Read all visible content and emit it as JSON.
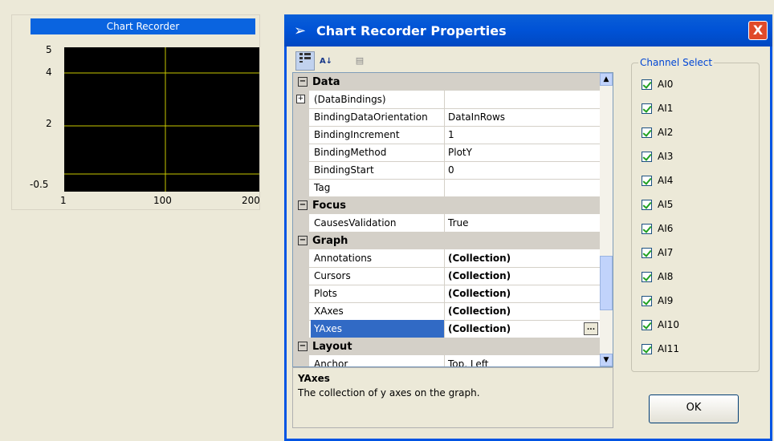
{
  "recorder": {
    "title": "Chart Recorder",
    "y_ticks": [
      "5",
      "4",
      "2",
      "-0.5"
    ],
    "x_ticks": [
      "1",
      "100",
      "200"
    ]
  },
  "dialog": {
    "title": "Chart Recorder Properties",
    "close_label": "X"
  },
  "grid": {
    "categories": [
      {
        "label": "Data"
      },
      {
        "label": "Focus"
      },
      {
        "label": "Graph"
      },
      {
        "label": "Layout"
      }
    ],
    "rows": [
      {
        "name": "(DataBindings)",
        "value": ""
      },
      {
        "name": "BindingDataOrientation",
        "value": "DataInRows"
      },
      {
        "name": "BindingIncrement",
        "value": "1"
      },
      {
        "name": "BindingMethod",
        "value": "PlotY"
      },
      {
        "name": "BindingStart",
        "value": "0"
      },
      {
        "name": "Tag",
        "value": ""
      },
      {
        "name": "CausesValidation",
        "value": "True"
      },
      {
        "name": "Annotations",
        "value": "(Collection)"
      },
      {
        "name": "Cursors",
        "value": "(Collection)"
      },
      {
        "name": "Plots",
        "value": "(Collection)"
      },
      {
        "name": "XAxes",
        "value": "(Collection)"
      },
      {
        "name": "YAxes",
        "value": "(Collection)"
      },
      {
        "name": "Anchor",
        "value": "Top, Left"
      }
    ]
  },
  "description": {
    "title": "YAxes",
    "text": "The collection of y axes on the graph."
  },
  "channels": {
    "legend": "Channel Select",
    "items": [
      "AI0",
      "AI1",
      "AI2",
      "AI3",
      "AI4",
      "AI5",
      "AI6",
      "AI7",
      "AI8",
      "AI9",
      "AI10",
      "AI11"
    ]
  },
  "ok_label": "OK",
  "colors": {
    "title_blue": "#0a64e0",
    "gridline": "#c8c800",
    "selection": "#316ac5"
  }
}
